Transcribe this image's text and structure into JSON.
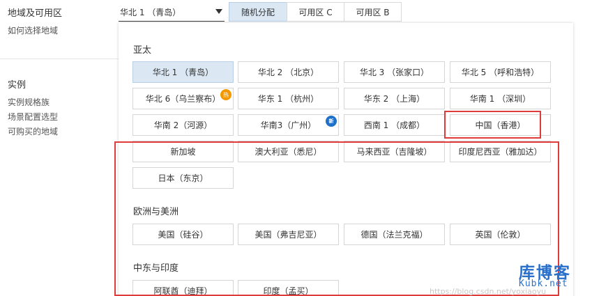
{
  "left": {
    "region_title": "地域及可用区",
    "region_help": "如何选择地域",
    "instance_title": "实例",
    "instance_links": [
      "实例规格族",
      "场景配置选型",
      "可购买的地域"
    ]
  },
  "selector": {
    "selected_region": "华北 1 （青岛）",
    "zones": [
      "随机分配",
      "可用区 C",
      "可用区 B"
    ],
    "active_zone_index": 0
  },
  "dropdown": {
    "groups": [
      {
        "title": "亚太",
        "items": [
          "华北 1 （青岛）",
          "华北 2 （北京）",
          "华北 3 （张家口）",
          "华北 5 （呼和浩特）",
          "华北 6（乌兰察布）",
          "华东 1 （杭州）",
          "华东 2 （上海）",
          "华南 1 （深圳）",
          "华南 2（河源）",
          "华南3（广州）",
          "西南 1 （成都）",
          "中国（香港）",
          "新加坡",
          "澳大利亚（悉尼）",
          "马来西亚（吉隆坡）",
          "印度尼西亚（雅加达）",
          "日本（东京）"
        ]
      },
      {
        "title": "欧洲与美洲",
        "items": [
          "美国（硅谷）",
          "美国（弗吉尼亚）",
          "德国（法兰克福）",
          "英国（伦敦）"
        ]
      },
      {
        "title": "中东与印度",
        "items": [
          "阿联酋（迪拜）",
          "印度（孟买）"
        ]
      }
    ],
    "badges": {
      "hot": "热",
      "new": "新"
    },
    "colors": {
      "selected_bg": "#dbe8f4",
      "annotation_red": "#e03b3b",
      "hot_badge": "#f39800",
      "new_badge": "#1e70c8"
    }
  },
  "watermark": {
    "title": "库博客",
    "subtitle": "Kubk.net",
    "url": "https://blog.csdn.net/yoxiaoyu"
  }
}
